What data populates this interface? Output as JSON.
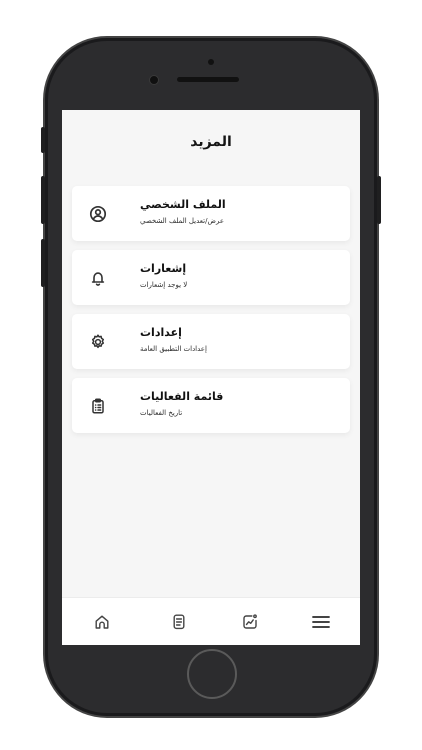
{
  "screen": {
    "title": "المزيد"
  },
  "menu": {
    "items": [
      {
        "title": "الملف الشخصي",
        "subtitle": "عرض/تعديل الملف الشخصي",
        "icon": "user-circle-icon"
      },
      {
        "title": "إشعارات",
        "subtitle": "لا يوجد إشعارات",
        "icon": "bell-icon"
      },
      {
        "title": "إعدادات",
        "subtitle": "إعدادات التطبيق العامة",
        "icon": "gear-icon"
      },
      {
        "title": "قائمة الفعاليات",
        "subtitle": "تاريخ الفعاليات",
        "icon": "clipboard-list-icon"
      }
    ]
  },
  "bottom_nav": {
    "items": [
      {
        "icon": "home-icon"
      },
      {
        "icon": "document-list-icon"
      },
      {
        "icon": "activity-chart-icon"
      },
      {
        "icon": "menu-icon",
        "active": true
      }
    ]
  },
  "colors": {
    "screen_background": "#f6f6f6",
    "card_background": "#ffffff",
    "phone_frame": "#2c2c2e",
    "text_primary": "#111111",
    "icon_stroke": "#333333"
  }
}
